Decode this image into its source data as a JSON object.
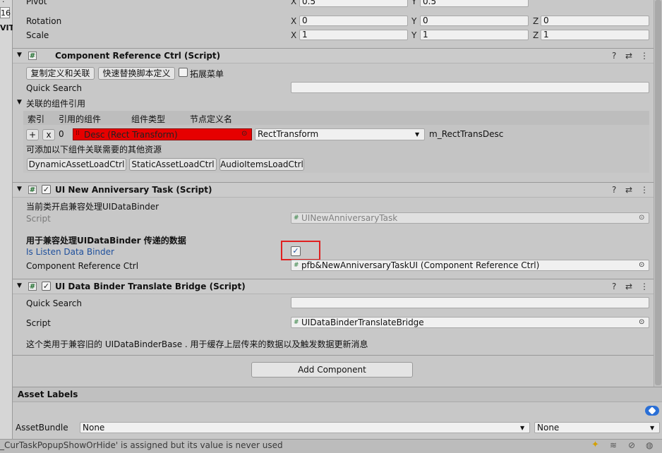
{
  "left_strip": {
    "dot": "·",
    "number": "16",
    "tag": "VIT"
  },
  "transform": {
    "pivot_label": "Pivot",
    "pivot_x": "0.5",
    "pivot_y": "0.5",
    "rotation_label": "Rotation",
    "rot_x": "0",
    "rot_y": "0",
    "rot_z": "0",
    "scale_label": "Scale",
    "scale_x": "1",
    "scale_y": "1",
    "scale_z": "1",
    "axis_x": "X",
    "axis_y": "Y",
    "axis_z": "Z"
  },
  "comp1": {
    "title": "Component Reference Ctrl (Script)",
    "btn_copy": "复制定义和关联",
    "btn_replace": "快速替换脚本定义",
    "extend_menu": "拓展菜单",
    "quick_search": "Quick Search",
    "quick_search_value": "",
    "related_section": "关联的组件引用",
    "cols": [
      "索引",
      "引用的组件",
      "组件类型",
      "节点定义名"
    ],
    "row": {
      "plus": "+",
      "x": "x",
      "index": "0",
      "component": "Desc (Rect Transform)",
      "type": "RectTransform",
      "name": "m_RectTransDesc"
    },
    "resource_hint": "可添加以下组件关联需要的其他资源",
    "resource_btns": [
      "DynamicAssetLoadCtrl",
      "StaticAssetLoadCtrl",
      "AudioItemsLoadCtrl"
    ]
  },
  "comp2": {
    "title": "UI New Anniversary Task (Script)",
    "compat_text": "当前类开启兼容处理UIDataBinder",
    "script_label": "Script",
    "script_value": "UINewAnniversaryTask",
    "bold_heading": "用于兼容处理UIDataBinder 传递的数据",
    "listen_label": "Is Listen Data Binder",
    "listen_checked": "✓",
    "ref_label": "Component Reference Ctrl",
    "ref_value": "pfb&NewAnniversaryTaskUI (Component Reference Ctrl)"
  },
  "comp3": {
    "title": "UI Data Binder Translate Bridge (Script)",
    "quick_search": "Quick Search",
    "quick_search_value": "",
    "script_label": "Script",
    "script_value": "UIDataBinderTranslateBridge",
    "desc": "这个类用于兼容旧的 UIDataBinderBase . 用于缓存上层传来的数据以及触发数据更新消息"
  },
  "add_component": "Add Component",
  "asset_labels": "Asset Labels",
  "asset_bundle": {
    "label": "AssetBundle",
    "value1": "None",
    "value2": "None"
  },
  "status": "_CurTaskPopupShowOrHide' is assigned but its value is never used",
  "colors": {
    "highlight_red": "#e00000",
    "selection_box": "#e02020",
    "blue_label": "#1e4f9c"
  },
  "icons": {
    "hash": "#",
    "help": "?",
    "preset": "⇄",
    "menu": "⋮",
    "picker": "⊙",
    "dropdown": "▼",
    "fold": "▼",
    "tag": "label-tag-icon"
  }
}
